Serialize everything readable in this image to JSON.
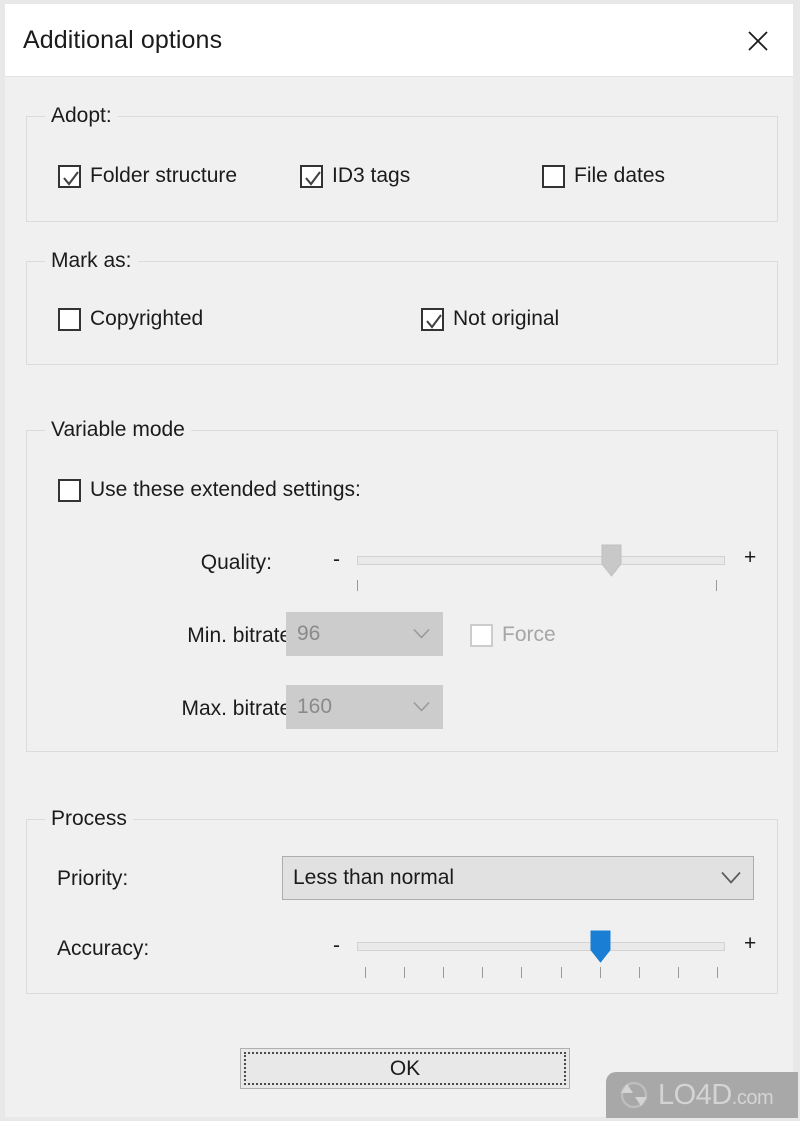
{
  "window": {
    "title": "Additional options",
    "close_icon": "close-x-icon"
  },
  "groups": {
    "adopt": {
      "title": "Adopt:",
      "checkboxes": [
        {
          "label": "Folder structure",
          "checked": true,
          "enabled": true
        },
        {
          "label": "ID3 tags",
          "checked": true,
          "enabled": true
        },
        {
          "label": "File dates",
          "checked": false,
          "enabled": true
        }
      ]
    },
    "mark_as": {
      "title": "Mark as:",
      "checkboxes": [
        {
          "label": "Copyrighted",
          "checked": false,
          "enabled": true
        },
        {
          "label": "Not original",
          "checked": true,
          "enabled": true
        }
      ]
    },
    "variable_mode": {
      "title": "Variable mode",
      "use_extended": {
        "label": "Use these extended settings:",
        "checked": false,
        "enabled": true
      },
      "quality": {
        "label": "Quality:",
        "minus": "-",
        "plus": "+",
        "value_percent": 69,
        "enabled": false,
        "tick_count": 2
      },
      "min_bitrate": {
        "label": "Min. bitrate:",
        "value": "96",
        "enabled": false
      },
      "max_bitrate": {
        "label": "Max. bitrate:",
        "value": "160",
        "enabled": false
      },
      "force": {
        "label": "Force",
        "checked": false,
        "enabled": false
      }
    },
    "process": {
      "title": "Process",
      "priority": {
        "label": "Priority:",
        "value": "Less than normal",
        "enabled": true,
        "arrow_icon": "chevron-down-icon"
      },
      "accuracy": {
        "label": "Accuracy:",
        "minus": "-",
        "plus": "+",
        "value_percent": 66,
        "enabled": true,
        "tick_count": 10
      }
    }
  },
  "footer": {
    "ok_label": "OK"
  },
  "watermark": {
    "text": "LO4D",
    "suffix": ".com",
    "logo_icon": "refresh-circle-arrows-icon"
  },
  "colors": {
    "accent": "#1a7fd4",
    "window_bg": "#f0f0f0",
    "titlebar_bg": "#ffffff",
    "text": "#1b1b1b",
    "disabled_text": "#8a8a8a",
    "group_border": "#dcdcdc"
  }
}
